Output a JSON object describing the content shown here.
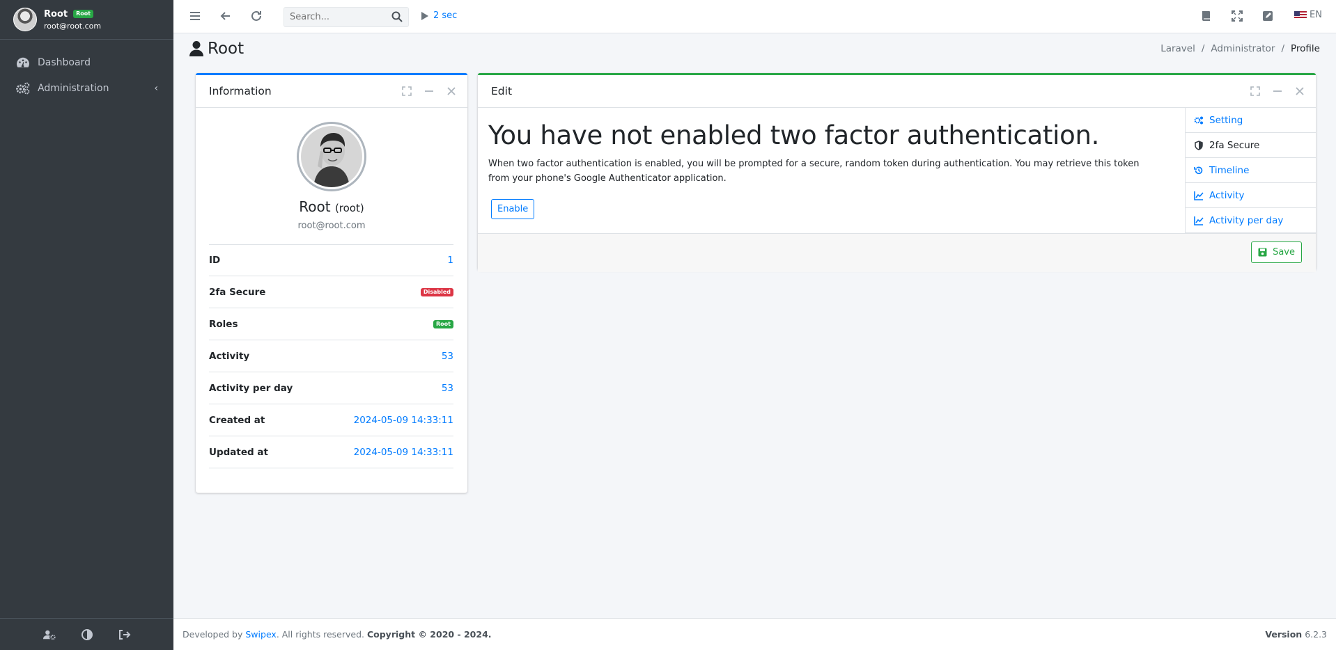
{
  "user": {
    "name": "Root",
    "badge": "Root",
    "email": "root@root.com"
  },
  "sidebar": {
    "items": [
      {
        "label": "Dashboard",
        "icon": "dashboard-icon"
      },
      {
        "label": "Administration",
        "icon": "gears-icon"
      }
    ],
    "bottom_icons": [
      "user-cog-icon",
      "contrast-icon",
      "sign-out-icon"
    ]
  },
  "topbar": {
    "search_placeholder": "Search...",
    "timer": "2 sec",
    "lang": "EN",
    "icons": [
      "menu-icon",
      "back-icon",
      "reload-icon",
      "book-icon",
      "fullscreen-icon",
      "edit-square-icon",
      "us-flag-icon"
    ]
  },
  "page": {
    "title": "Root",
    "breadcrumb": [
      "Laravel",
      "/",
      "Administrator",
      "/",
      "Profile"
    ]
  },
  "info_card": {
    "title": "Information",
    "name": "Root",
    "username": "(root)",
    "email": "root@root.com",
    "rows": [
      {
        "label": "ID",
        "value": "1"
      },
      {
        "label": "2fa Secure",
        "badge": "Disabled",
        "badge_color": "#dc3545"
      },
      {
        "label": "Roles",
        "badge": "Root",
        "badge_color": "#28a745"
      },
      {
        "label": "Activity",
        "value": "53"
      },
      {
        "label": "Activity per day",
        "value": "53"
      },
      {
        "label": "Created at",
        "value": "2024-05-09 14:33:11"
      },
      {
        "label": "Updated at",
        "value": "2024-05-09 14:33:11"
      }
    ]
  },
  "edit_card": {
    "title": "Edit",
    "heading": "You have not enabled two factor authentication.",
    "text": "When two factor authentication is enabled, you will be prompted for a secure, random token during authentication. You may retrieve this token from your phone's Google Authenticator application.",
    "enable_label": "Enable",
    "save_label": "Save",
    "side_nav": [
      "Setting",
      "2fa Secure",
      "Timeline",
      "Activity",
      "Activity per day"
    ]
  },
  "footer": {
    "developed_by": "Developed by",
    "brand": "Swipex",
    "rights": ". All rights reserved.",
    "copyright": "Copyright © 2020 - 2024.",
    "version_label": "Version",
    "version": "6.2.3"
  },
  "colors": {
    "primary": "#007bff",
    "success": "#28a745",
    "danger": "#dc3545",
    "sidebar": "#343a40"
  }
}
